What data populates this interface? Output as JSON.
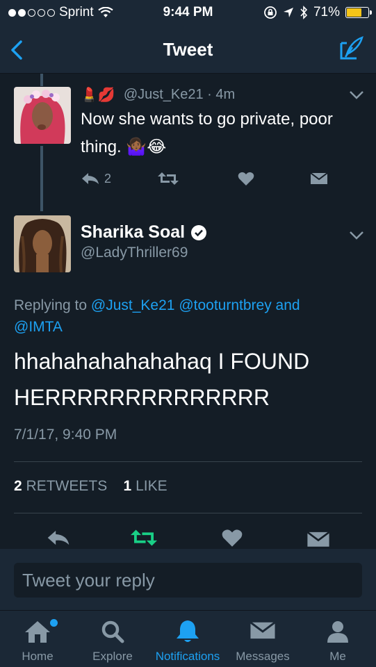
{
  "status_bar": {
    "carrier": "Sprint",
    "time": "9:44 PM",
    "battery": "71%",
    "battery_level": 0.71
  },
  "nav": {
    "title": "Tweet",
    "back_icon": "chevron-left-icon",
    "compose_icon": "compose-icon"
  },
  "parent_tweet": {
    "handle_time": "@Just_Ke21 · 4m",
    "text": "Now she wants to go private, poor thing.",
    "emojis": "🤷🏾‍♀️😂",
    "name_emojis": "💄💋",
    "reply_count": "2"
  },
  "main_tweet": {
    "name": "Sharika Soal",
    "handle": "@LadyThriller69",
    "replying_prefix": "Replying to",
    "replying_to": [
      "@Just_Ke21",
      "@tooturntbrey"
    ],
    "replying_and": "and",
    "replying_last": "@IMTA",
    "text": "hhahahahahahahaq I FOUND HERRRRRRRRRRRRRR",
    "date": "7/1/17, 9:40 PM",
    "retweets_count": "2",
    "retweets_label": "RETWEETS",
    "likes_count": "1",
    "likes_label": "LIKE"
  },
  "reply_box": {
    "placeholder": "Tweet your reply"
  },
  "tabbar": {
    "items": [
      {
        "label": "Home",
        "icon": "home-icon"
      },
      {
        "label": "Explore",
        "icon": "search-icon"
      },
      {
        "label": "Notifications",
        "icon": "bell-icon"
      },
      {
        "label": "Messages",
        "icon": "envelope-icon"
      },
      {
        "label": "Me",
        "icon": "person-icon"
      }
    ]
  },
  "colors": {
    "background": "#141d26",
    "bar": "#1b2836",
    "accent": "#1da1f2",
    "muted": "#8899a6",
    "retweet_green": "#19cf86"
  }
}
